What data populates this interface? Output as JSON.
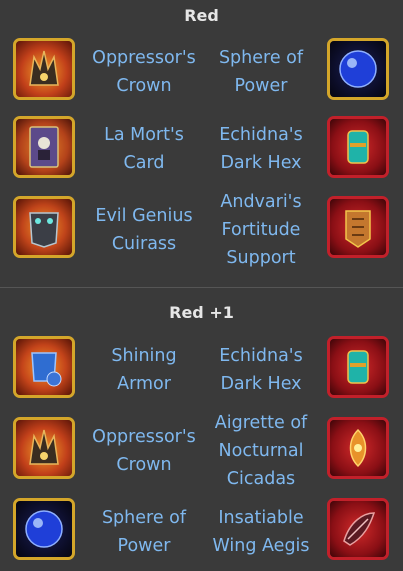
{
  "sections": [
    {
      "title": "Red",
      "rows": [
        {
          "left": {
            "name": "Oppressor's Crown",
            "icon": "oppressors-crown-icon"
          },
          "right": {
            "name": "Sphere of Power",
            "icon": "sphere-of-power-icon"
          }
        },
        {
          "left": {
            "name": "La Mort's Card",
            "icon": "la-morts-card-icon"
          },
          "right": {
            "name": "Echidna's Dark Hex",
            "icon": "echidnas-dark-hex-icon"
          }
        },
        {
          "left": {
            "name": "Evil Genius Cuirass",
            "icon": "evil-genius-cuirass-icon"
          },
          "right": {
            "name": "Andvari's Fortitude Support",
            "icon": "andvaris-fortitude-support-icon"
          }
        }
      ]
    },
    {
      "title": "Red +1",
      "rows": [
        {
          "left": {
            "name": "Shining Armor",
            "icon": "shining-armor-icon"
          },
          "right": {
            "name": "Echidna's Dark Hex",
            "icon": "echidnas-dark-hex-icon"
          }
        },
        {
          "left": {
            "name": "Oppressor's Crown",
            "icon": "oppressors-crown-icon"
          },
          "right": {
            "name": "Aigrette of Nocturnal Cicadas",
            "icon": "aigrette-of-nocturnal-cicadas-icon"
          }
        },
        {
          "left": {
            "name": "Sphere of Power",
            "icon": "sphere-of-power-icon"
          },
          "right": {
            "name": "Insatiable Wing Aegis",
            "icon": "insatiable-wing-aegis-icon"
          }
        }
      ]
    }
  ],
  "colors": {
    "background": "#3a3a3a",
    "title": "#e6e6e6",
    "item_name": "#7fb8ef",
    "gold_frame": "#d4a62a",
    "red_frame": "#c2202a"
  }
}
